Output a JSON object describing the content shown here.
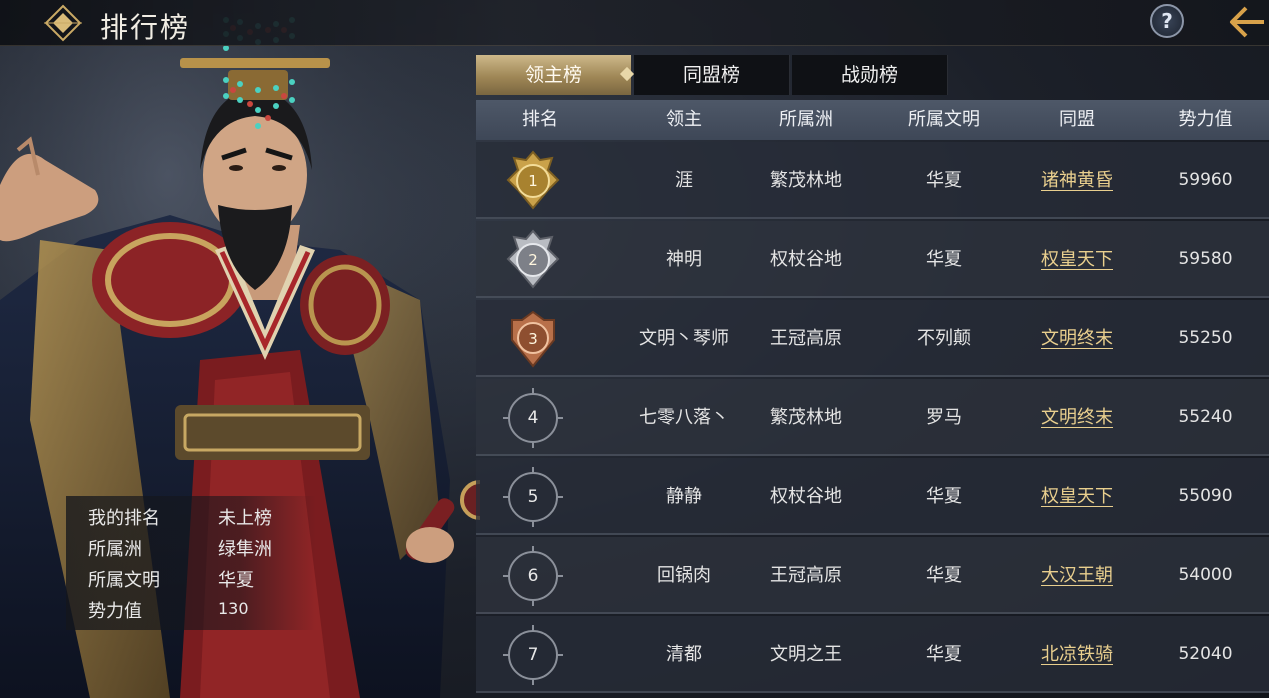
{
  "header": {
    "title": "排行榜",
    "help_glyph": "?"
  },
  "tabs": [
    {
      "label": "领主榜",
      "active": true
    },
    {
      "label": "同盟榜",
      "active": false
    },
    {
      "label": "战勋榜",
      "active": false
    }
  ],
  "columns": [
    "排名",
    "领主",
    "所属洲",
    "所属文明",
    "同盟",
    "势力值"
  ],
  "rows": [
    {
      "rank": "1",
      "lord": "涯",
      "continent": "繁茂林地",
      "civilization": "华夏",
      "alliance": "诸神黄昏",
      "power": "59960",
      "badge": "gold-medal"
    },
    {
      "rank": "2",
      "lord": "神明",
      "continent": "权杖谷地",
      "civilization": "华夏",
      "alliance": "权皇天下",
      "power": "59580",
      "badge": "silver-medal"
    },
    {
      "rank": "3",
      "lord": "文明丶琴师",
      "continent": "王冠高原",
      "civilization": "不列颠",
      "alliance": "文明终末",
      "power": "55250",
      "badge": "bronze-medal"
    },
    {
      "rank": "4",
      "lord": "七零八落丶",
      "continent": "繁茂林地",
      "civilization": "罗马",
      "alliance": "文明终末",
      "power": "55240",
      "badge": "ring"
    },
    {
      "rank": "5",
      "lord": "静静",
      "continent": "权杖谷地",
      "civilization": "华夏",
      "alliance": "权皇天下",
      "power": "55090",
      "badge": "ring"
    },
    {
      "rank": "6",
      "lord": "回锅肉",
      "continent": "王冠高原",
      "civilization": "华夏",
      "alliance": "大汉王朝",
      "power": "54000",
      "badge": "ring"
    },
    {
      "rank": "7",
      "lord": "清都",
      "continent": "文明之王",
      "civilization": "华夏",
      "alliance": "北凉铁骑",
      "power": "52040",
      "badge": "ring"
    }
  ],
  "my_info": {
    "rank_label": "我的排名",
    "rank_value": "未上榜",
    "continent_label": "所属洲",
    "continent_value": "绿隼洲",
    "civ_label": "所属文明",
    "civ_value": "华夏",
    "power_label": "势力值",
    "power_value": "130"
  },
  "colors": {
    "gold": "#e9cf8e",
    "tab_active": "#b39c6a",
    "header_bar": "#465061"
  }
}
